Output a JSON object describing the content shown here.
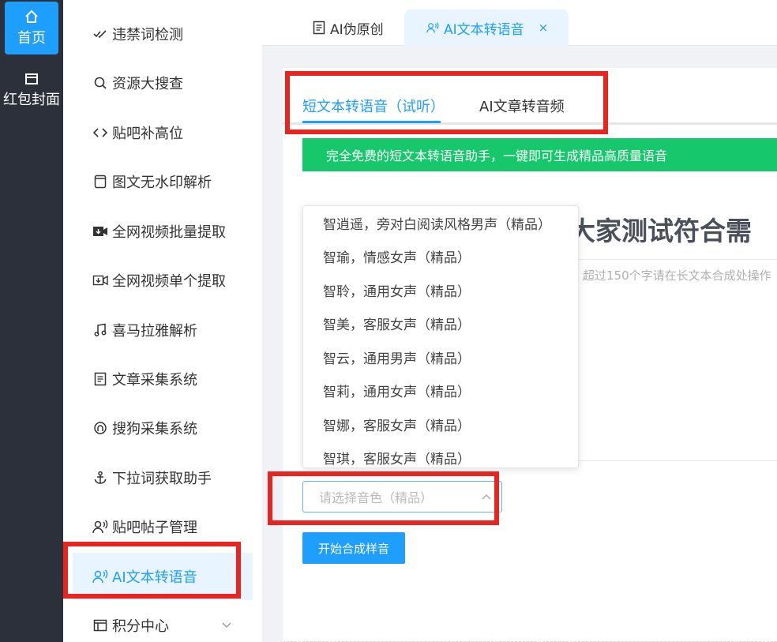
{
  "rail": {
    "home_label": "首页",
    "home_icon": "home-icon",
    "redpacket_label": "红包封面",
    "redpacket_icon": "card-icon"
  },
  "menu": {
    "items": [
      {
        "label": "违禁词检测",
        "icon": "check-double-icon"
      },
      {
        "label": "资源大搜查",
        "icon": "search-icon"
      },
      {
        "label": "贴吧补高位",
        "icon": "code-icon"
      },
      {
        "label": "图文无水印解析",
        "icon": "window-icon"
      },
      {
        "label": "全网视频批量提取",
        "icon": "video-download-icon"
      },
      {
        "label": "全网视频单个提取",
        "icon": "video-icon"
      },
      {
        "label": "喜马拉雅解析",
        "icon": "music-icon"
      },
      {
        "label": "文章采集系统",
        "icon": "document-icon"
      },
      {
        "label": "搜狗采集系统",
        "icon": "badge-icon"
      },
      {
        "label": "下拉词获取助手",
        "icon": "anchor-icon"
      },
      {
        "label": "贴吧帖子管理",
        "icon": "voice-user-icon"
      },
      {
        "label": "AI文本转语音",
        "icon": "voice-user-icon",
        "active": true
      },
      {
        "label": "积分中心",
        "icon": "panel-icon"
      }
    ]
  },
  "tabs": [
    {
      "label": "AI伪原创",
      "icon": "document-icon"
    },
    {
      "label": "AI文本转语音",
      "icon": "voice-user-icon",
      "close": "×"
    }
  ],
  "main": {
    "inner_tabs": [
      "短文本转语音（试听）",
      "AI文章转音频"
    ],
    "banner": "完全免费的短文本转语音助手，一键即可生成精品高质量语音",
    "title_fragment": "大家测试符合需",
    "hint": "超过150个字请在长文本合成处操作",
    "voice_options": [
      "智逍遥，旁对白阅读风格男声（精品）",
      "智瑜，情感女声（精品）",
      "智聆，通用女声（精品）",
      "智美，客服女声（精品）",
      "智云，通用男声（精品）",
      "智莉，通用女声（精品）",
      "智娜，客服女声（精品）",
      "智琪，客服女声（精品）"
    ],
    "select_placeholder": "请选择音色（精品）",
    "start_button": "开始合成样音"
  },
  "colors": {
    "accent": "#1e9fff",
    "banner_green": "#16c76b",
    "rail_bg": "#2b303b",
    "annotation_red": "#e8251f"
  }
}
